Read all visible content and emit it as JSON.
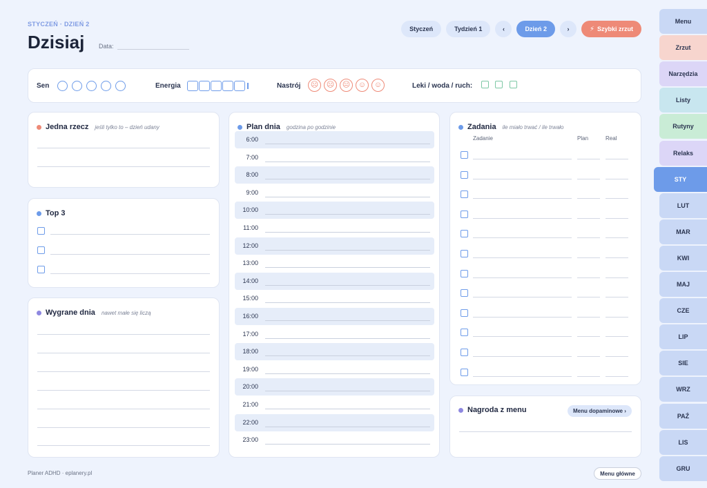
{
  "header": {
    "eyebrow": "STYCZEŃ · DZIEŃ 2",
    "title": "Dzisiaj",
    "date_label": "Data:"
  },
  "topnav": {
    "month": "Styczeń",
    "week": "Tydzień 1",
    "prev": "‹",
    "day": "Dzień 2",
    "next": "›",
    "quick_dump": "Szybki zrzut"
  },
  "tracker": {
    "sleep_label": "Sen",
    "energy_label": "Energia",
    "mood_label": "Nastrój",
    "mood_faces": [
      "☹",
      "☹",
      "😐",
      "☺",
      "☺"
    ],
    "meds_label": "Leki / woda / ruch:"
  },
  "one_thing": {
    "title": "Jedna rzecz",
    "subtitle": "jeśli tylko to – dzień udany"
  },
  "top3": {
    "title": "Top 3"
  },
  "wins": {
    "title": "Wygrane dnia",
    "subtitle": "nawet małe się liczą"
  },
  "plan": {
    "title": "Plan dnia",
    "subtitle": "godzina po godzinie",
    "hours": [
      "6:00",
      "7:00",
      "8:00",
      "9:00",
      "10:00",
      "11:00",
      "12:00",
      "13:00",
      "14:00",
      "15:00",
      "16:00",
      "17:00",
      "18:00",
      "19:00",
      "20:00",
      "21:00",
      "22:00",
      "23:00"
    ]
  },
  "tasks": {
    "title": "Zadania",
    "subtitle": "ile miało trwać / ile trwało",
    "col_task": "Zadanie",
    "col_plan": "Plan",
    "col_real": "Real"
  },
  "reward": {
    "title": "Nagroda z menu",
    "button": "Menu dopaminowe ›"
  },
  "footer": {
    "text": "Planer ADHD · eplanery.pl",
    "button": "Menu główne"
  },
  "sidebar": [
    {
      "label": "Menu",
      "color": "#c9d8f5"
    },
    {
      "label": "Zrzut",
      "color": "#f7d5ce"
    },
    {
      "label": "Narzędzia",
      "color": "#dcd6f7"
    },
    {
      "label": "Listy",
      "color": "#c8e6ef"
    },
    {
      "label": "Rutyny",
      "color": "#c9ecd6"
    },
    {
      "label": "Relaks",
      "color": "#dcd6f7"
    },
    {
      "label": "STY",
      "color": "#6d9be9",
      "active": true
    },
    {
      "label": "LUT",
      "color": "#c9d8f5"
    },
    {
      "label": "MAR",
      "color": "#c9d8f5"
    },
    {
      "label": "KWI",
      "color": "#c9d8f5"
    },
    {
      "label": "MAJ",
      "color": "#c9d8f5"
    },
    {
      "label": "CZE",
      "color": "#c9d8f5"
    },
    {
      "label": "LIP",
      "color": "#c9d8f5"
    },
    {
      "label": "SIE",
      "color": "#c9d8f5"
    },
    {
      "label": "WRZ",
      "color": "#c9d8f5"
    },
    {
      "label": "PAŹ",
      "color": "#c9d8f5"
    },
    {
      "label": "LIS",
      "color": "#c9d8f5"
    },
    {
      "label": "GRU",
      "color": "#c9d8f5"
    }
  ],
  "colors": {
    "accent_blue": "#6d9be9",
    "accent_coral": "#ee8a77",
    "accent_green": "#7cc7a4",
    "accent_purple": "#8e88e0"
  }
}
